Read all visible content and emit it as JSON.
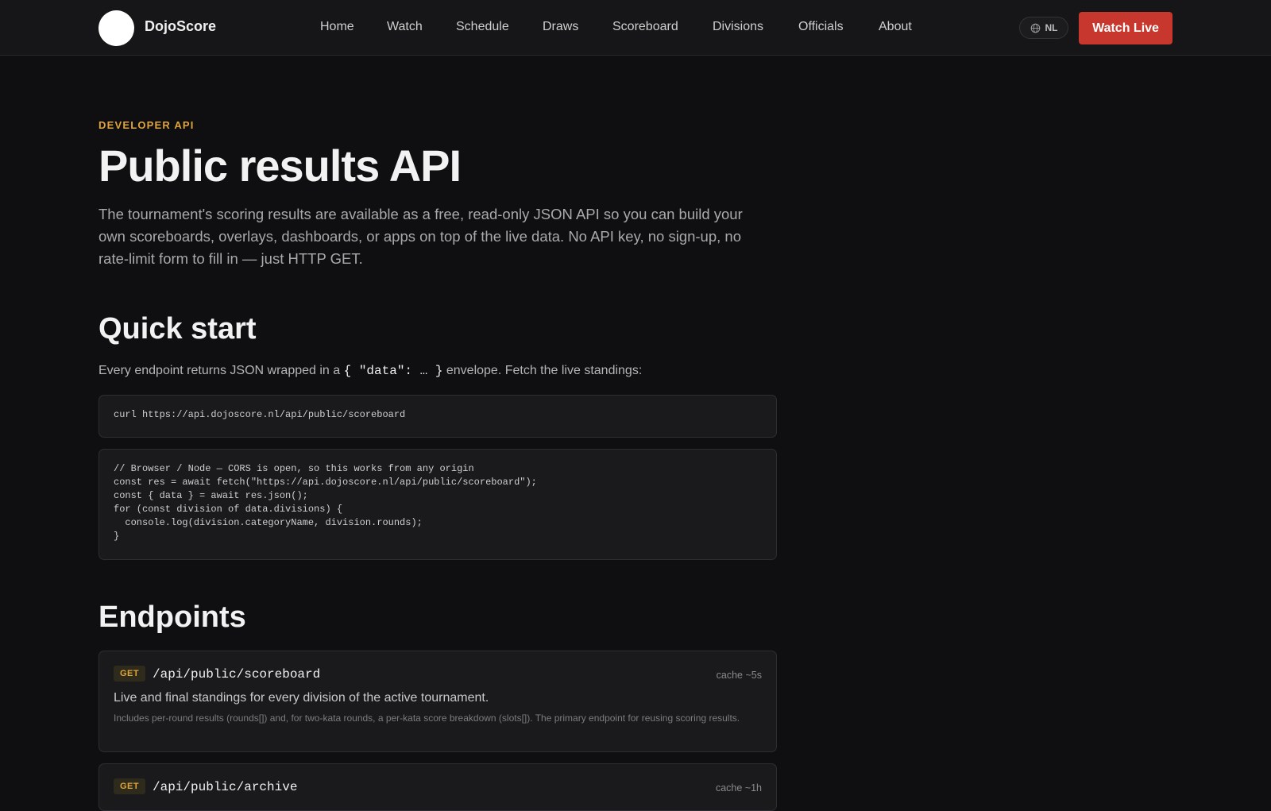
{
  "header": {
    "brand": "DojoScore",
    "nav": [
      "Home",
      "Watch",
      "Schedule",
      "Draws",
      "Scoreboard",
      "Divisions",
      "Officials",
      "About"
    ],
    "lang_label": "NL",
    "cta_label": "Watch Live",
    "cta_color": "#c7372d"
  },
  "hero": {
    "eyebrow": "DEVELOPER API",
    "title": "Public results API",
    "intro": "The tournament's scoring results are available as a free, read-only JSON API so you can build your own scoreboards, overlays, dashboards, or apps on top of the live data. No API key, no sign-up, no rate-limit form to fill in — just HTTP GET."
  },
  "quick_start": {
    "heading": "Quick start",
    "text_before": "Every endpoint returns JSON wrapped in a ",
    "inline_code": "{ \"data\": … }",
    "text_after": " envelope. Fetch the live standings:",
    "curl": "curl https://api.dojoscore.nl/api/public/scoreboard",
    "js": "// Browser / Node — CORS is open, so this works from any origin\nconst res = await fetch(\"https://api.dojoscore.nl/api/public/scoreboard\");\nconst { data } = await res.json();\nfor (const division of data.divisions) {\n  console.log(division.categoryName, division.rounds);\n}"
  },
  "endpoints": {
    "heading": "Endpoints",
    "items": [
      {
        "method": "GET",
        "path": "/api/public/scoreboard",
        "cache": "cache ~5s",
        "description": "Live and final standings for every division of the active tournament.",
        "detail": "Includes per-round results (rounds[]) and, for two-kata rounds, a per-kata score breakdown (slots[]). The primary endpoint for reusing scoring results."
      },
      {
        "method": "GET",
        "path": "/api/public/archive",
        "cache": "cache ~1h",
        "description": "",
        "detail": ""
      }
    ]
  },
  "accent_color": "#e0a53a"
}
